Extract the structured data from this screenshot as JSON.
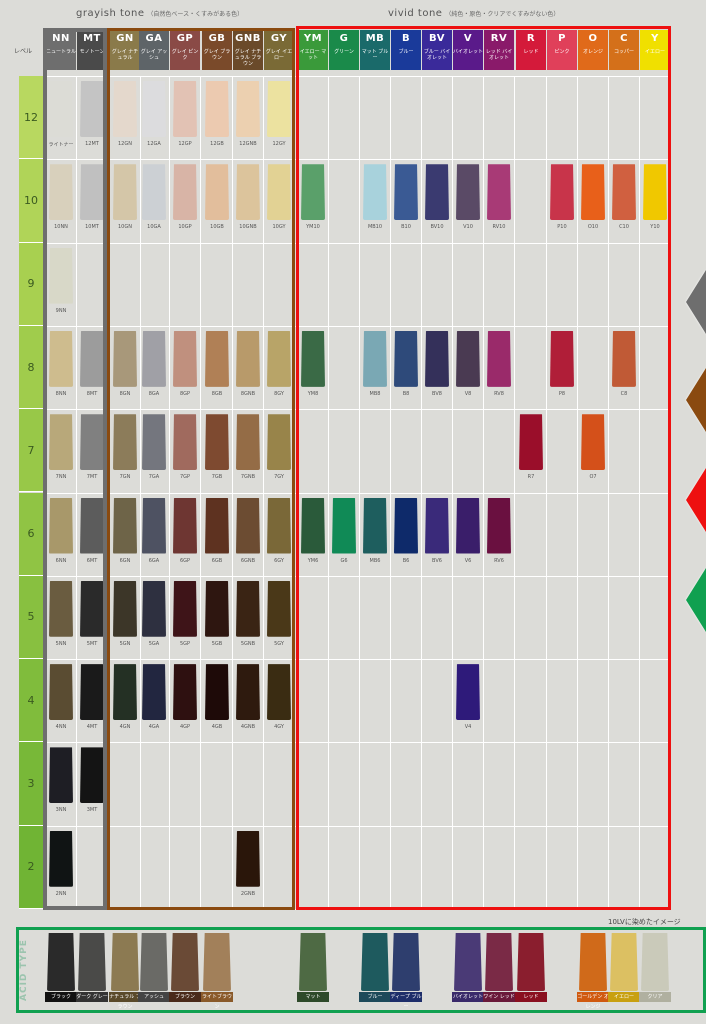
{
  "header": {
    "grayish_title": "grayish tone",
    "grayish_sub": "（自然色ベース・くすみがある色）",
    "vivid_title": "vivid tone",
    "vivid_sub": "（純色・原色・クリアでくすみがない色）",
    "level_label": "レベル"
  },
  "columns": [
    {
      "code": "NN",
      "name": "ニュートラル",
      "color": "#6e6e6e"
    },
    {
      "code": "MT",
      "name": "モノトーン",
      "color": "#4a4a4a"
    },
    {
      "code": "GN",
      "name": "グレイ ナチュラル",
      "color": "#8a7a4a"
    },
    {
      "code": "GA",
      "name": "グレイ アッシュ",
      "color": "#5e6468"
    },
    {
      "code": "GP",
      "name": "グレイ ピンク",
      "color": "#8a4a46"
    },
    {
      "code": "GB",
      "name": "グレイ ブラウン",
      "color": "#7a4a2a"
    },
    {
      "code": "GNB",
      "name": "グレイ ナチュラル ブラウン",
      "color": "#6a4a2a"
    },
    {
      "code": "GY",
      "name": "グレイ イエロー",
      "color": "#7a6a36"
    },
    {
      "code": "YM",
      "name": "イエロー マット",
      "color": "#3a9a3a"
    },
    {
      "code": "G",
      "name": "グリーン",
      "color": "#1a8a4a"
    },
    {
      "code": "MB",
      "name": "マット ブルー",
      "color": "#1a6a6a"
    },
    {
      "code": "B",
      "name": "ブルー",
      "color": "#1a3a9a"
    },
    {
      "code": "BV",
      "name": "ブルー バイオレット",
      "color": "#3a2a9a"
    },
    {
      "code": "V",
      "name": "バイオレット",
      "color": "#5a1a8a"
    },
    {
      "code": "RV",
      "name": "レッド バイオレット",
      "color": "#8a1a6a"
    },
    {
      "code": "R",
      "name": "レッド",
      "color": "#d41a3a"
    },
    {
      "code": "P",
      "name": "ピンク",
      "color": "#e0405a"
    },
    {
      "code": "O",
      "name": "オレンジ",
      "color": "#e06a1a"
    },
    {
      "code": "C",
      "name": "コッパー",
      "color": "#d4701a"
    },
    {
      "code": "Y",
      "name": "イエロー",
      "color": "#f0e000"
    }
  ],
  "levels": [
    "12",
    "10",
    "9",
    "8",
    "7",
    "6",
    "5",
    "4",
    "3",
    "2"
  ],
  "swatches": [
    {
      "col": 0,
      "row": 0,
      "label": "ライトナー",
      "color": "#dcdcd6"
    },
    {
      "col": 1,
      "row": 0,
      "label": "12MT",
      "color": "#c4c4c4"
    },
    {
      "col": 2,
      "row": 0,
      "label": "12GN",
      "color": "#e4d8cc"
    },
    {
      "col": 3,
      "row": 0,
      "label": "12GA",
      "color": "#dcdcde"
    },
    {
      "col": 4,
      "row": 0,
      "label": "12GP",
      "color": "#e2c2b4"
    },
    {
      "col": 5,
      "row": 0,
      "label": "12GB",
      "color": "#eccab0"
    },
    {
      "col": 6,
      "row": 0,
      "label": "12GNB",
      "color": "#ecd0b0"
    },
    {
      "col": 7,
      "row": 0,
      "label": "12GY",
      "color": "#ece2a0"
    },
    {
      "col": 0,
      "row": 1,
      "label": "10NN",
      "color": "#d8d0bc"
    },
    {
      "col": 1,
      "row": 1,
      "label": "10MT",
      "color": "#c0c0c0"
    },
    {
      "col": 2,
      "row": 1,
      "label": "10GN",
      "color": "#d4c6a8"
    },
    {
      "col": 3,
      "row": 1,
      "label": "10GA",
      "color": "#ccd0d4"
    },
    {
      "col": 4,
      "row": 1,
      "label": "10GP",
      "color": "#d8b4a6"
    },
    {
      "col": 5,
      "row": 1,
      "label": "10GB",
      "color": "#e2be9c"
    },
    {
      "col": 6,
      "row": 1,
      "label": "10GNB",
      "color": "#dcc49c"
    },
    {
      "col": 7,
      "row": 1,
      "label": "10GY",
      "color": "#e2d294"
    },
    {
      "col": 8,
      "row": 1,
      "label": "YM10",
      "color": "#5aa06a"
    },
    {
      "col": 10,
      "row": 1,
      "label": "MB10",
      "color": "#a8d2dc"
    },
    {
      "col": 11,
      "row": 1,
      "label": "B10",
      "color": "#3a5a94"
    },
    {
      "col": 12,
      "row": 1,
      "label": "BV10",
      "color": "#3a3a70"
    },
    {
      "col": 13,
      "row": 1,
      "label": "V10",
      "color": "#5a4a66"
    },
    {
      "col": 14,
      "row": 1,
      "label": "RV10",
      "color": "#a83a76"
    },
    {
      "col": 16,
      "row": 1,
      "label": "P10",
      "color": "#c8344a"
    },
    {
      "col": 17,
      "row": 1,
      "label": "O10",
      "color": "#e8601a"
    },
    {
      "col": 18,
      "row": 1,
      "label": "C10",
      "color": "#d06040"
    },
    {
      "col": 19,
      "row": 1,
      "label": "Y10",
      "color": "#f0c800"
    },
    {
      "col": 0,
      "row": 2,
      "label": "9NN",
      "color": "#d8d8c8"
    },
    {
      "col": 0,
      "row": 3,
      "label": "8NN",
      "color": "#cebc8e"
    },
    {
      "col": 1,
      "row": 3,
      "label": "8MT",
      "color": "#9c9c9c"
    },
    {
      "col": 2,
      "row": 3,
      "label": "8GN",
      "color": "#a8987a"
    },
    {
      "col": 3,
      "row": 3,
      "label": "8GA",
      "color": "#a0a0a6"
    },
    {
      "col": 4,
      "row": 3,
      "label": "8GP",
      "color": "#c0907e"
    },
    {
      "col": 5,
      "row": 3,
      "label": "8GB",
      "color": "#b08056"
    },
    {
      "col": 6,
      "row": 3,
      "label": "8GNB",
      "color": "#b89a6a"
    },
    {
      "col": 7,
      "row": 3,
      "label": "8GY",
      "color": "#b8a468"
    },
    {
      "col": 8,
      "row": 3,
      "label": "YM8",
      "color": "#3a6a46"
    },
    {
      "col": 10,
      "row": 3,
      "label": "MB8",
      "color": "#7aa8b4"
    },
    {
      "col": 11,
      "row": 3,
      "label": "B8",
      "color": "#2e4a7a"
    },
    {
      "col": 12,
      "row": 3,
      "label": "BV8",
      "color": "#34305a"
    },
    {
      "col": 13,
      "row": 3,
      "label": "V8",
      "color": "#4a3a52"
    },
    {
      "col": 14,
      "row": 3,
      "label": "RV8",
      "color": "#9a2a6a"
    },
    {
      "col": 16,
      "row": 3,
      "label": "P8",
      "color": "#b01e38"
    },
    {
      "col": 18,
      "row": 3,
      "label": "C8",
      "color": "#c05a36"
    },
    {
      "col": 0,
      "row": 4,
      "label": "7NN",
      "color": "#b8a87a"
    },
    {
      "col": 1,
      "row": 4,
      "label": "7MT",
      "color": "#808080"
    },
    {
      "col": 2,
      "row": 4,
      "label": "7GN",
      "color": "#8c7c5a"
    },
    {
      "col": 3,
      "row": 4,
      "label": "7GA",
      "color": "#74767e"
    },
    {
      "col": 4,
      "row": 4,
      "label": "7GP",
      "color": "#a06a5e"
    },
    {
      "col": 5,
      "row": 4,
      "label": "7GB",
      "color": "#7e4a30"
    },
    {
      "col": 6,
      "row": 4,
      "label": "7GNB",
      "color": "#946c46"
    },
    {
      "col": 7,
      "row": 4,
      "label": "7GY",
      "color": "#98844a"
    },
    {
      "col": 15,
      "row": 4,
      "label": "R7",
      "color": "#9a0e2a"
    },
    {
      "col": 17,
      "row": 4,
      "label": "O7",
      "color": "#d4501a"
    },
    {
      "col": 0,
      "row": 5,
      "label": "6NN",
      "color": "#a8986a"
    },
    {
      "col": 1,
      "row": 5,
      "label": "6MT",
      "color": "#5c5c5c"
    },
    {
      "col": 2,
      "row": 5,
      "label": "6GN",
      "color": "#6e6448"
    },
    {
      "col": 3,
      "row": 5,
      "label": "6GA",
      "color": "#4e5262"
    },
    {
      "col": 4,
      "row": 5,
      "label": "6GP",
      "color": "#6e3632"
    },
    {
      "col": 5,
      "row": 5,
      "label": "6GB",
      "color": "#5e3220"
    },
    {
      "col": 6,
      "row": 5,
      "label": "6GNB",
      "color": "#6c4c32"
    },
    {
      "col": 7,
      "row": 5,
      "label": "6GY",
      "color": "#7a6838"
    },
    {
      "col": 8,
      "row": 5,
      "label": "YM6",
      "color": "#2a5a3a"
    },
    {
      "col": 9,
      "row": 5,
      "label": "G6",
      "color": "#108a56"
    },
    {
      "col": 10,
      "row": 5,
      "label": "MB6",
      "color": "#1e5e5e"
    },
    {
      "col": 11,
      "row": 5,
      "label": "B6",
      "color": "#0e2a6a"
    },
    {
      "col": 12,
      "row": 5,
      "label": "BV6",
      "color": "#3a2a7a"
    },
    {
      "col": 13,
      "row": 5,
      "label": "V6",
      "color": "#3a1e6a"
    },
    {
      "col": 14,
      "row": 5,
      "label": "RV6",
      "color": "#6a1040"
    },
    {
      "col": 0,
      "row": 6,
      "label": "5NN",
      "color": "#6a5c40"
    },
    {
      "col": 1,
      "row": 6,
      "label": "5MT",
      "color": "#2a2a2a"
    },
    {
      "col": 2,
      "row": 6,
      "label": "5GN",
      "color": "#3c3628"
    },
    {
      "col": 3,
      "row": 6,
      "label": "5GA",
      "color": "#2e3040"
    },
    {
      "col": 4,
      "row": 6,
      "label": "5GP",
      "color": "#3e1418"
    },
    {
      "col": 5,
      "row": 6,
      "label": "5GB",
      "color": "#2e1610"
    },
    {
      "col": 6,
      "row": 6,
      "label": "5GNB",
      "color": "#3a2414"
    },
    {
      "col": 7,
      "row": 6,
      "label": "5GY",
      "color": "#4a3818"
    },
    {
      "col": 0,
      "row": 7,
      "label": "4NN",
      "color": "#5a4c32"
    },
    {
      "col": 1,
      "row": 7,
      "label": "4MT",
      "color": "#1a1a1a"
    },
    {
      "col": 2,
      "row": 7,
      "label": "4GN",
      "color": "#243024"
    },
    {
      "col": 3,
      "row": 7,
      "label": "4GA",
      "color": "#222640"
    },
    {
      "col": 4,
      "row": 7,
      "label": "4GP",
      "color": "#2e1010"
    },
    {
      "col": 5,
      "row": 7,
      "label": "4GB",
      "color": "#1e0a08"
    },
    {
      "col": 6,
      "row": 7,
      "label": "4GNB",
      "color": "#2e1a0e"
    },
    {
      "col": 7,
      "row": 7,
      "label": "4GY",
      "color": "#3a2c12"
    },
    {
      "col": 13,
      "row": 7,
      "label": "V4",
      "color": "#2e1a7a"
    },
    {
      "col": 0,
      "row": 8,
      "label": "3NN",
      "color": "#1e1e24"
    },
    {
      "col": 1,
      "row": 8,
      "label": "3MT",
      "color": "#141414"
    },
    {
      "col": 0,
      "row": 9,
      "label": "2NN",
      "color": "#101414"
    },
    {
      "col": 6,
      "row": 9,
      "label": "2GNB",
      "color": "#2a160a"
    }
  ],
  "acid": {
    "title": "ACID TYPE",
    "note": "10LVに染めたイメージ",
    "items": [
      {
        "col": 0,
        "label": "ブラック",
        "color": "#2a2a2a",
        "tag": "#111111"
      },
      {
        "col": 1,
        "label": "ダーク グレー",
        "color": "#4a4a48",
        "tag": "#333333"
      },
      {
        "col": 2,
        "label": "ナチュラル ブラウン",
        "color": "#8c7a52",
        "tag": "#5a4a2a"
      },
      {
        "col": 3,
        "label": "アッシュ",
        "color": "#6a6a66",
        "tag": "#444444"
      },
      {
        "col": 4,
        "label": "ブラウン",
        "color": "#6a4a36",
        "tag": "#4a2a1a"
      },
      {
        "col": 5,
        "label": "ライトブラウン",
        "color": "#a2805a",
        "tag": "#8a5a2a"
      },
      {
        "col": 8,
        "label": "マット",
        "color": "#4e6a44",
        "tag": "#2e4a2a"
      },
      {
        "col": 10,
        "label": "ブルー",
        "color": "#1e5a5e",
        "tag": "#1e4a5a"
      },
      {
        "col": 11,
        "label": "ディープ ブルー",
        "color": "#2e3e6e",
        "tag": "#1e2e6a"
      },
      {
        "col": 13,
        "label": "バイオレット",
        "color": "#4a3a76",
        "tag": "#3a2a6a"
      },
      {
        "col": 14,
        "label": "ワイン レッド",
        "color": "#7a2a46",
        "tag": "#6a1a3a"
      },
      {
        "col": 15,
        "label": "レッド",
        "color": "#8a1e2e",
        "tag": "#8a1020"
      },
      {
        "col": 17,
        "label": "ゴールデン オレンジ",
        "color": "#d06a1a",
        "tag": "#d05a10"
      },
      {
        "col": 18,
        "label": "イエロー",
        "color": "#dcc062",
        "tag": "#c8a010"
      },
      {
        "col": 19,
        "label": "クリア",
        "color": "#cacaba",
        "tag": "#b0b0a0"
      }
    ]
  },
  "arrows": [
    {
      "color": "#6e6e6e"
    },
    {
      "color": "#8a4a10"
    },
    {
      "color": "#ee1010"
    },
    {
      "color": "#10a050"
    }
  ],
  "frames": {
    "nn_mt": "#6e6e6e",
    "grayish": "#8a4a10",
    "vivid": "#ee1010",
    "acid": "#10a050"
  }
}
